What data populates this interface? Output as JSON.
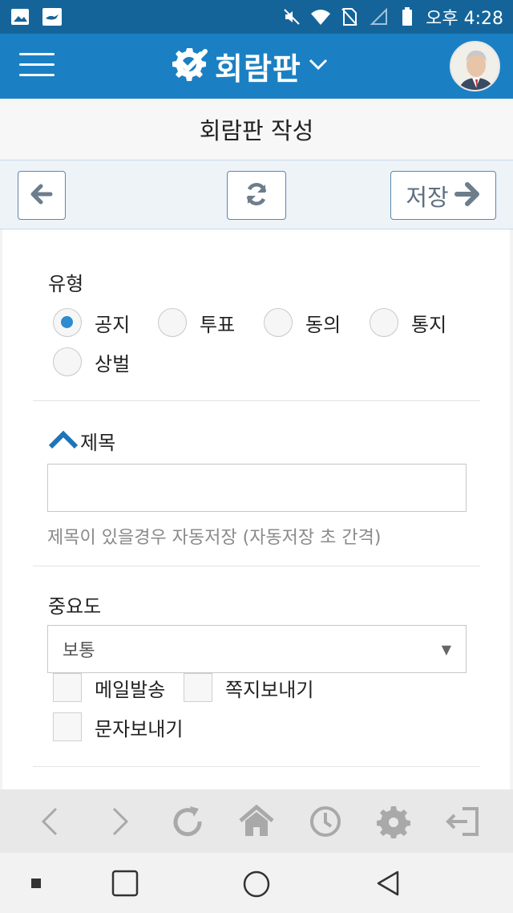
{
  "status_bar": {
    "time": "오후 4:28",
    "left_icons": [
      "image-icon",
      "lamp-icon"
    ],
    "right_icons": [
      "mute-icon",
      "wifi-icon",
      "no-sim-icon",
      "signal-icon",
      "battery-icon"
    ]
  },
  "app_bar": {
    "title": "회람판",
    "logo_icon": "gear-check-icon",
    "menu_icon": "hamburger-icon",
    "dropdown_icon": "chevron-down-icon",
    "avatar": "user-avatar"
  },
  "page": {
    "title": "회람판 작성"
  },
  "toolbar": {
    "back_icon": "arrow-left-icon",
    "refresh_icon": "refresh-icon",
    "save_label": "저장",
    "save_icon": "arrow-right-icon"
  },
  "form": {
    "type_label": "유형",
    "type_options": [
      {
        "label": "공지",
        "checked": true
      },
      {
        "label": "투표",
        "checked": false
      },
      {
        "label": "동의",
        "checked": false
      },
      {
        "label": "통지",
        "checked": false
      },
      {
        "label": "상벌",
        "checked": false
      }
    ],
    "subject_label": "제목",
    "subject_value": "",
    "subject_hint": "제목이 있을경우 자동저장 (자동저장 초 간격)",
    "importance_label": "중요도",
    "importance_value": "보통",
    "checkboxes": [
      {
        "label": "메일발송",
        "checked": false
      },
      {
        "label": "쪽지보내기",
        "checked": false
      },
      {
        "label": "문자보내기",
        "checked": false
      }
    ]
  },
  "colors": {
    "status_bar": "#14649a",
    "app_bar": "#1b80c3",
    "accent": "#2d8bd0",
    "button_border": "#5b87ad"
  },
  "browser_nav": [
    "back-icon",
    "forward-icon",
    "reload-icon",
    "home-icon",
    "history-icon",
    "settings-icon",
    "logout-icon"
  ],
  "system_nav": [
    "dot-icon",
    "recents-icon",
    "home-circle-icon",
    "back-triangle-icon"
  ]
}
